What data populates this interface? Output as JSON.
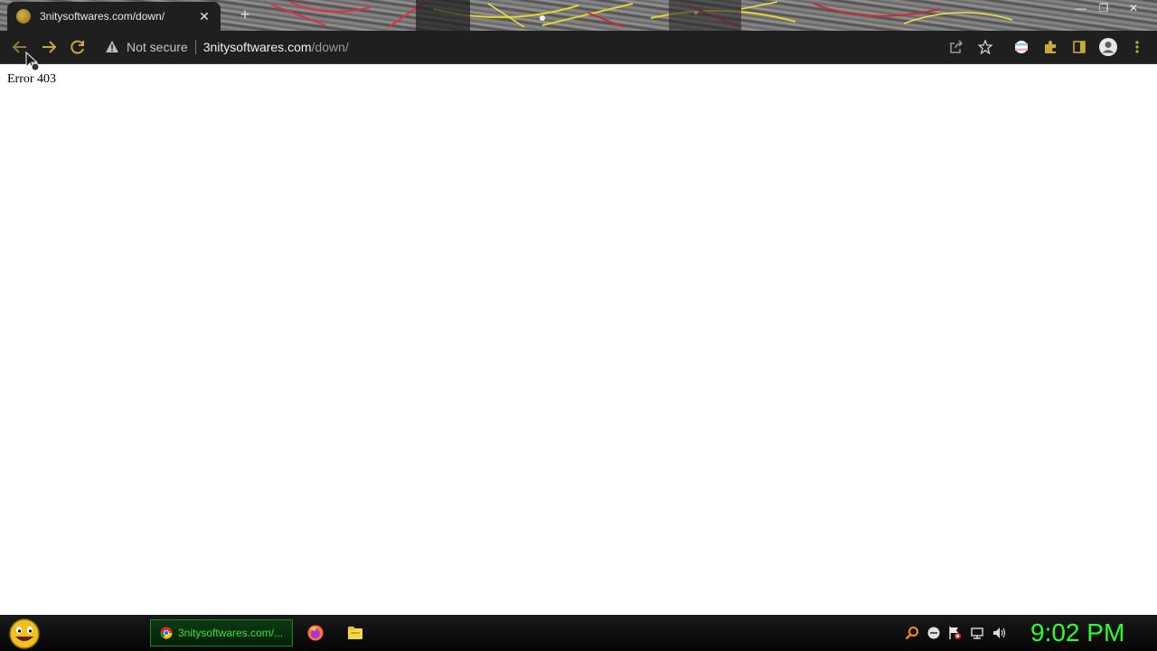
{
  "browser": {
    "tab_title": "3nitysoftwares.com/down/",
    "tab_close": "✕",
    "new_tab": "+",
    "window_controls": {
      "minimize": "—",
      "restore": "❐",
      "close": "✕"
    },
    "security_label": "Not secure",
    "url_host": "3nitysoftwares.com",
    "url_path": "/down/",
    "icons": [
      "back-icon",
      "forward-icon",
      "reload-icon",
      "warning-icon",
      "share-icon",
      "star-icon",
      "extension-profile-icon",
      "puzzle-icon",
      "sidepanel-icon",
      "profile-icon",
      "menu-icon"
    ]
  },
  "page": {
    "error_text": "Error 403"
  },
  "taskbar": {
    "task_label": "3nitysoftwares.com/...",
    "clock": "9:02 PM",
    "colors": {
      "clock": "#2bff2b",
      "task_border": "#0b8a20"
    }
  }
}
